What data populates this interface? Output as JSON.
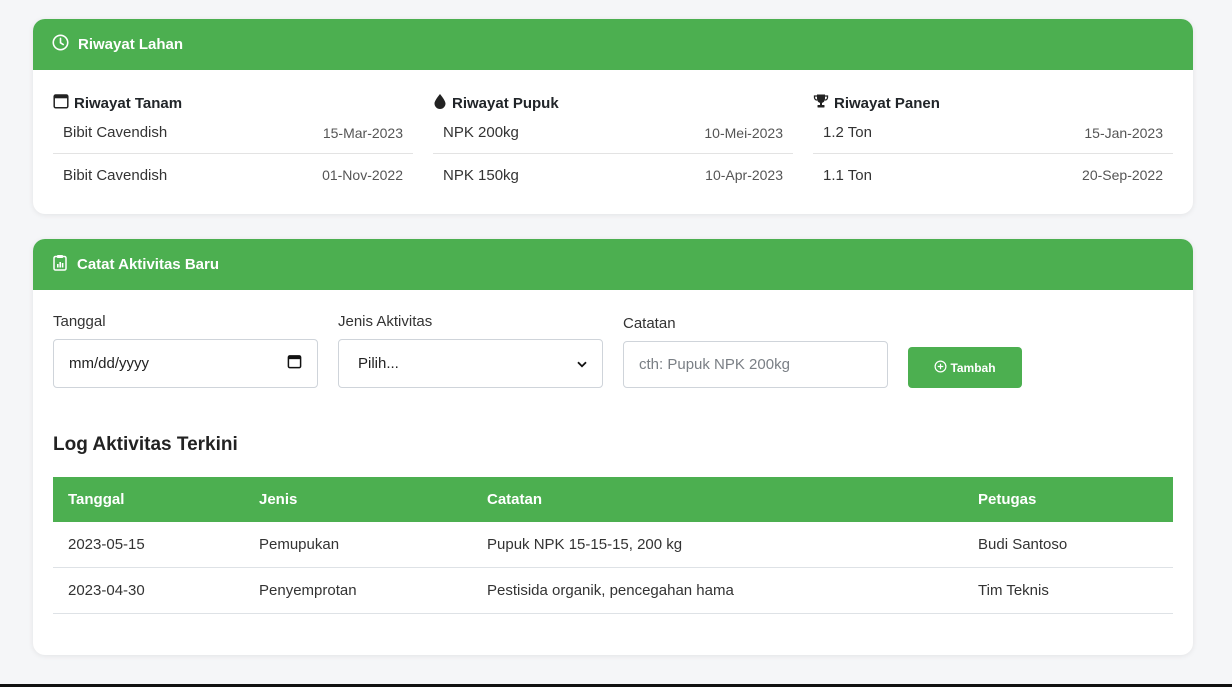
{
  "history_card": {
    "title": "Riwayat Lahan",
    "columns": [
      {
        "title": "Riwayat Tanam",
        "icon": "calendar-icon",
        "rows": [
          {
            "value": "Bibit Cavendish",
            "date": "15-Mar-2023"
          },
          {
            "value": "Bibit Cavendish",
            "date": "01-Nov-2022"
          }
        ]
      },
      {
        "title": "Riwayat Pupuk",
        "icon": "droplet-icon",
        "rows": [
          {
            "value": "NPK 200kg",
            "date": "10-Mei-2023"
          },
          {
            "value": "NPK 150kg",
            "date": "10-Apr-2023"
          }
        ]
      },
      {
        "title": "Riwayat Panen",
        "icon": "trophy-icon",
        "rows": [
          {
            "value": "1.2 Ton",
            "date": "15-Jan-2023"
          },
          {
            "value": "1.1 Ton",
            "date": "20-Sep-2022"
          }
        ]
      }
    ]
  },
  "activity_card": {
    "title": "Catat Aktivitas Baru",
    "form": {
      "date_label": "Tanggal",
      "date_placeholder": "mm/dd/yyyy",
      "type_label": "Jenis Aktivitas",
      "type_selected": "Pilih...",
      "note_label": "Catatan",
      "note_placeholder": "cth: Pupuk NPK 200kg",
      "add_button": "Tambah"
    },
    "log": {
      "title": "Log Aktivitas Terkini",
      "headers": [
        "Tanggal",
        "Jenis",
        "Catatan",
        "Petugas"
      ],
      "rows": [
        [
          "2023-05-15",
          "Pemupukan",
          "Pupuk NPK 15-15-15, 200 kg",
          "Budi Santoso"
        ],
        [
          "2023-04-30",
          "Penyemprotan",
          "Pestisida organik, pencegahan hama",
          "Tim Teknis"
        ]
      ]
    }
  },
  "colors": {
    "accent": "#4caf50",
    "background": "#f5f6f8"
  }
}
